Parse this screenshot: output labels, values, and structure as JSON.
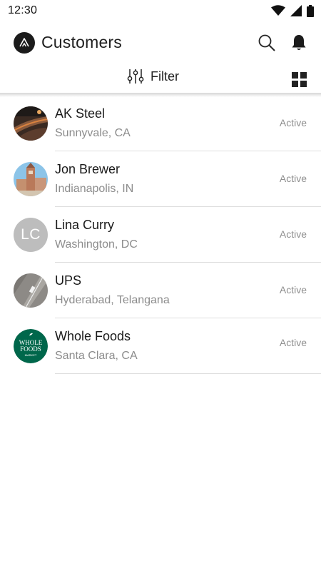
{
  "status_bar": {
    "time": "12:30"
  },
  "app_bar": {
    "title": "Customers",
    "logo_icon": "brand-logo-icon",
    "search_icon": "search-icon",
    "bell_icon": "bell-icon"
  },
  "filter_bar": {
    "filter_label": "Filter",
    "filter_icon": "sliders-icon",
    "view_icon": "grid-view-icon"
  },
  "customers": [
    {
      "name": "AK Steel",
      "location": "Sunnyvale, CA",
      "status": "Active",
      "avatar": "photo"
    },
    {
      "name": "Jon Brewer",
      "location": "Indianapolis, IN",
      "status": "Active",
      "avatar": "photo"
    },
    {
      "name": "Lina Curry",
      "location": "Washington, DC",
      "status": "Active",
      "avatar": "initials",
      "initials": "LC"
    },
    {
      "name": "UPS",
      "location": "Hyderabad, Telangana",
      "status": "Active",
      "avatar": "photo"
    },
    {
      "name": "Whole Foods",
      "location": "Santa Clara, CA",
      "status": "Active",
      "avatar": "logo",
      "logo_text": [
        "WHOLE",
        "FOODS",
        "MARKET"
      ]
    }
  ],
  "colors": {
    "accent": "#1b1b1b",
    "status_text": "#8f8f8f",
    "whole_foods_green": "#00674b",
    "initials_bg": "#bdbdbd"
  }
}
